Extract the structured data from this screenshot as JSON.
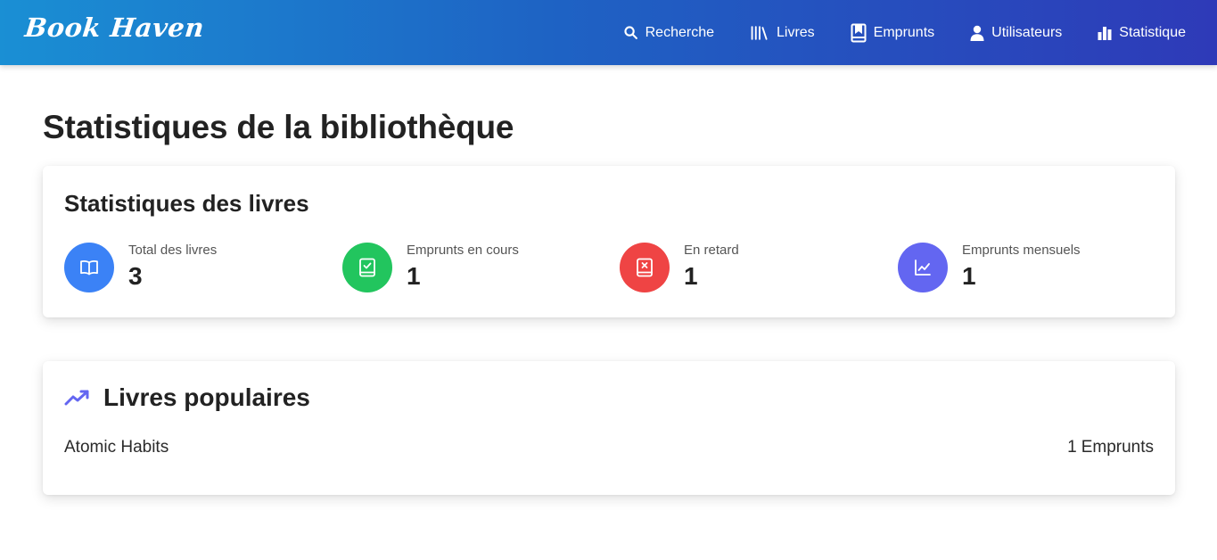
{
  "brand": "Book Haven",
  "nav": {
    "search": "Recherche",
    "books": "Livres",
    "loans": "Emprunts",
    "users": "Utilisateurs",
    "stats": "Statistique"
  },
  "page_title": "Statistiques de la bibliothèque",
  "book_stats": {
    "title": "Statistiques des livres",
    "items": [
      {
        "label": "Total des livres",
        "value": "3",
        "color": "#3b82f6",
        "icon": "open-book-icon"
      },
      {
        "label": "Emprunts en cours",
        "value": "1",
        "color": "#22c55e",
        "icon": "book-check-icon"
      },
      {
        "label": "En retard",
        "value": "1",
        "color": "#ef4444",
        "icon": "book-x-icon"
      },
      {
        "label": "Emprunts mensuels",
        "value": "1",
        "color": "#6366f1",
        "icon": "line-chart-icon"
      }
    ]
  },
  "popular": {
    "title": "Livres populaires",
    "icon": "trending-up-icon",
    "icon_color": "#6366f1",
    "items": [
      {
        "title": "Atomic Habits",
        "count": "1",
        "unit": "Emprunts"
      }
    ]
  }
}
